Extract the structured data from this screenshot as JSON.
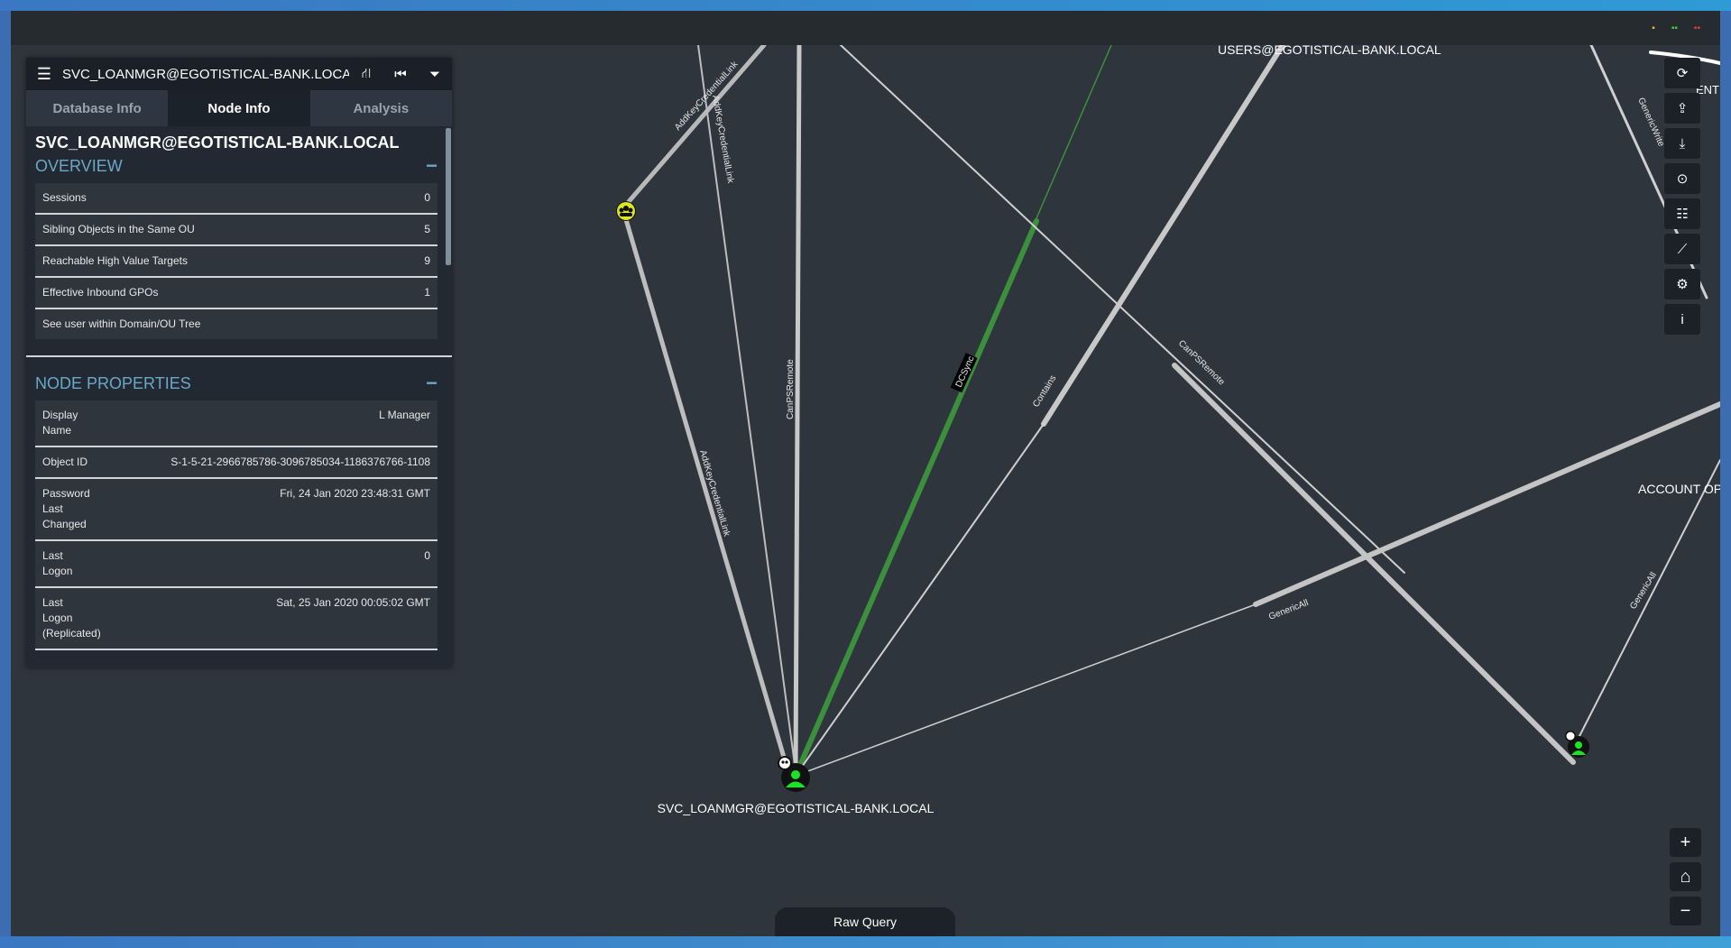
{
  "window": {
    "titlebar_dots": [
      "#e8b94a",
      "#44cc44",
      "#d94545"
    ]
  },
  "search": {
    "value": "SVC_LOANMGR@EGOTISTICAL-BANK.LOCAL"
  },
  "header_icons": [
    "road-icon",
    "step-backward-icon",
    "filter-icon"
  ],
  "tabs": [
    {
      "label": "Database Info",
      "active": false
    },
    {
      "label": "Node Info",
      "active": true
    },
    {
      "label": "Analysis",
      "active": false
    }
  ],
  "node_info": {
    "title": "SVC_LOANMGR@EGOTISTICAL-BANK.LOCAL",
    "overview": {
      "heading": "OVERVIEW",
      "toggle": "−",
      "rows": [
        {
          "key": "Sessions",
          "value": "0"
        },
        {
          "key": "Sibling Objects in the Same OU",
          "value": "5"
        },
        {
          "key": "Reachable High Value Targets",
          "value": "9"
        },
        {
          "key": "Effective Inbound GPOs",
          "value": "1"
        },
        {
          "key": "See user within Domain/OU Tree",
          "value": ""
        }
      ]
    },
    "properties": {
      "heading": "NODE PROPERTIES",
      "toggle": "−",
      "rows": [
        {
          "key": "Display Name",
          "value": "L Manager"
        },
        {
          "key": "Object ID",
          "value": "S-1-5-21-2966785786-3096785034-1186376766-1108"
        },
        {
          "key": "Password Last Changed",
          "value": "Fri, 24 Jan 2020 23:48:31 GMT"
        },
        {
          "key": "Last Logon",
          "value": "0"
        },
        {
          "key": "Last Logon (Replicated)",
          "value": "Sat, 25 Jan 2020 00:05:02 GMT"
        }
      ]
    }
  },
  "graph": {
    "node_labels": {
      "main": "SVC_LOANMGR@EGOTISTICAL-BANK.LOCAL",
      "users": "USERS@EGOTISTICAL-BANK.LOCAL",
      "account_op": "ACCOUNT OP",
      "ent": "ENT"
    },
    "edge_labels": {
      "addkey_top": "AddKeyCredentialLink",
      "addkey_top2": "AddKeyCredentialLink",
      "addkey_mid": "AddKeyCredentialLink",
      "canpsremote_v": "CanPSRemote",
      "dcsync": "DCSync",
      "contains": "Contains",
      "canpsremote_d": "CanPSRemote",
      "genericall_long": "GenericAll",
      "genericall_right": "GenericAll",
      "genericwrite": "GenericWrite"
    },
    "highlight_color": "#3c8f3c",
    "user_node_color": "#17e625",
    "group_node_color": "#dbe625"
  },
  "toolbar": [
    "refresh-icon",
    "upload-icon",
    "download-icon",
    "circle-up-icon",
    "tasks-icon",
    "chart-line-icon",
    "cogs-icon",
    "info-icon"
  ],
  "zoom": {
    "in": "+",
    "home": "⌂",
    "out": "−"
  },
  "raw_query": {
    "label": "Raw Query"
  }
}
